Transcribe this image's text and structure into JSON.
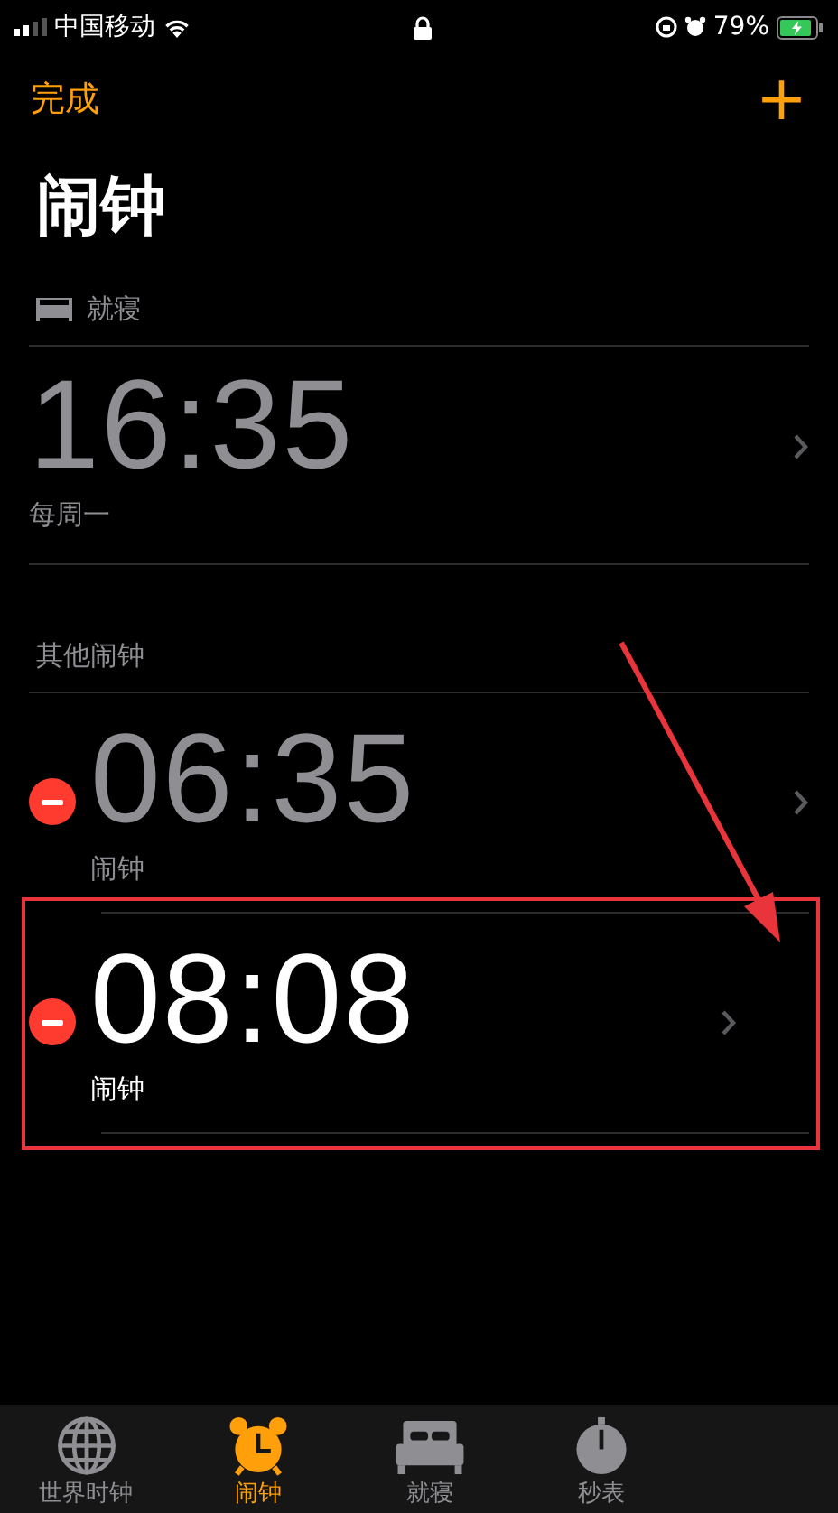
{
  "status_bar": {
    "carrier": "中国移动",
    "battery": "79%"
  },
  "nav": {
    "left": "完成",
    "right": "+"
  },
  "title": "闹钟",
  "sleep_section": {
    "header": "就寝",
    "time": "16:35",
    "detail": "每周一"
  },
  "other_header": "其他闹钟",
  "alarms": [
    {
      "time": "06:35",
      "label": "闹钟",
      "enabled": false,
      "highlighted": false
    },
    {
      "time": "08:08",
      "label": "闹钟",
      "enabled": true,
      "highlighted": true
    }
  ],
  "tabs": [
    {
      "kind": "globe",
      "label": "世界时钟",
      "selected": false
    },
    {
      "kind": "alarm",
      "label": "闹钟",
      "selected": true
    },
    {
      "kind": "bed",
      "label": "就寝",
      "selected": false
    },
    {
      "kind": "stopwatch",
      "label": "秒表",
      "selected": false
    }
  ]
}
